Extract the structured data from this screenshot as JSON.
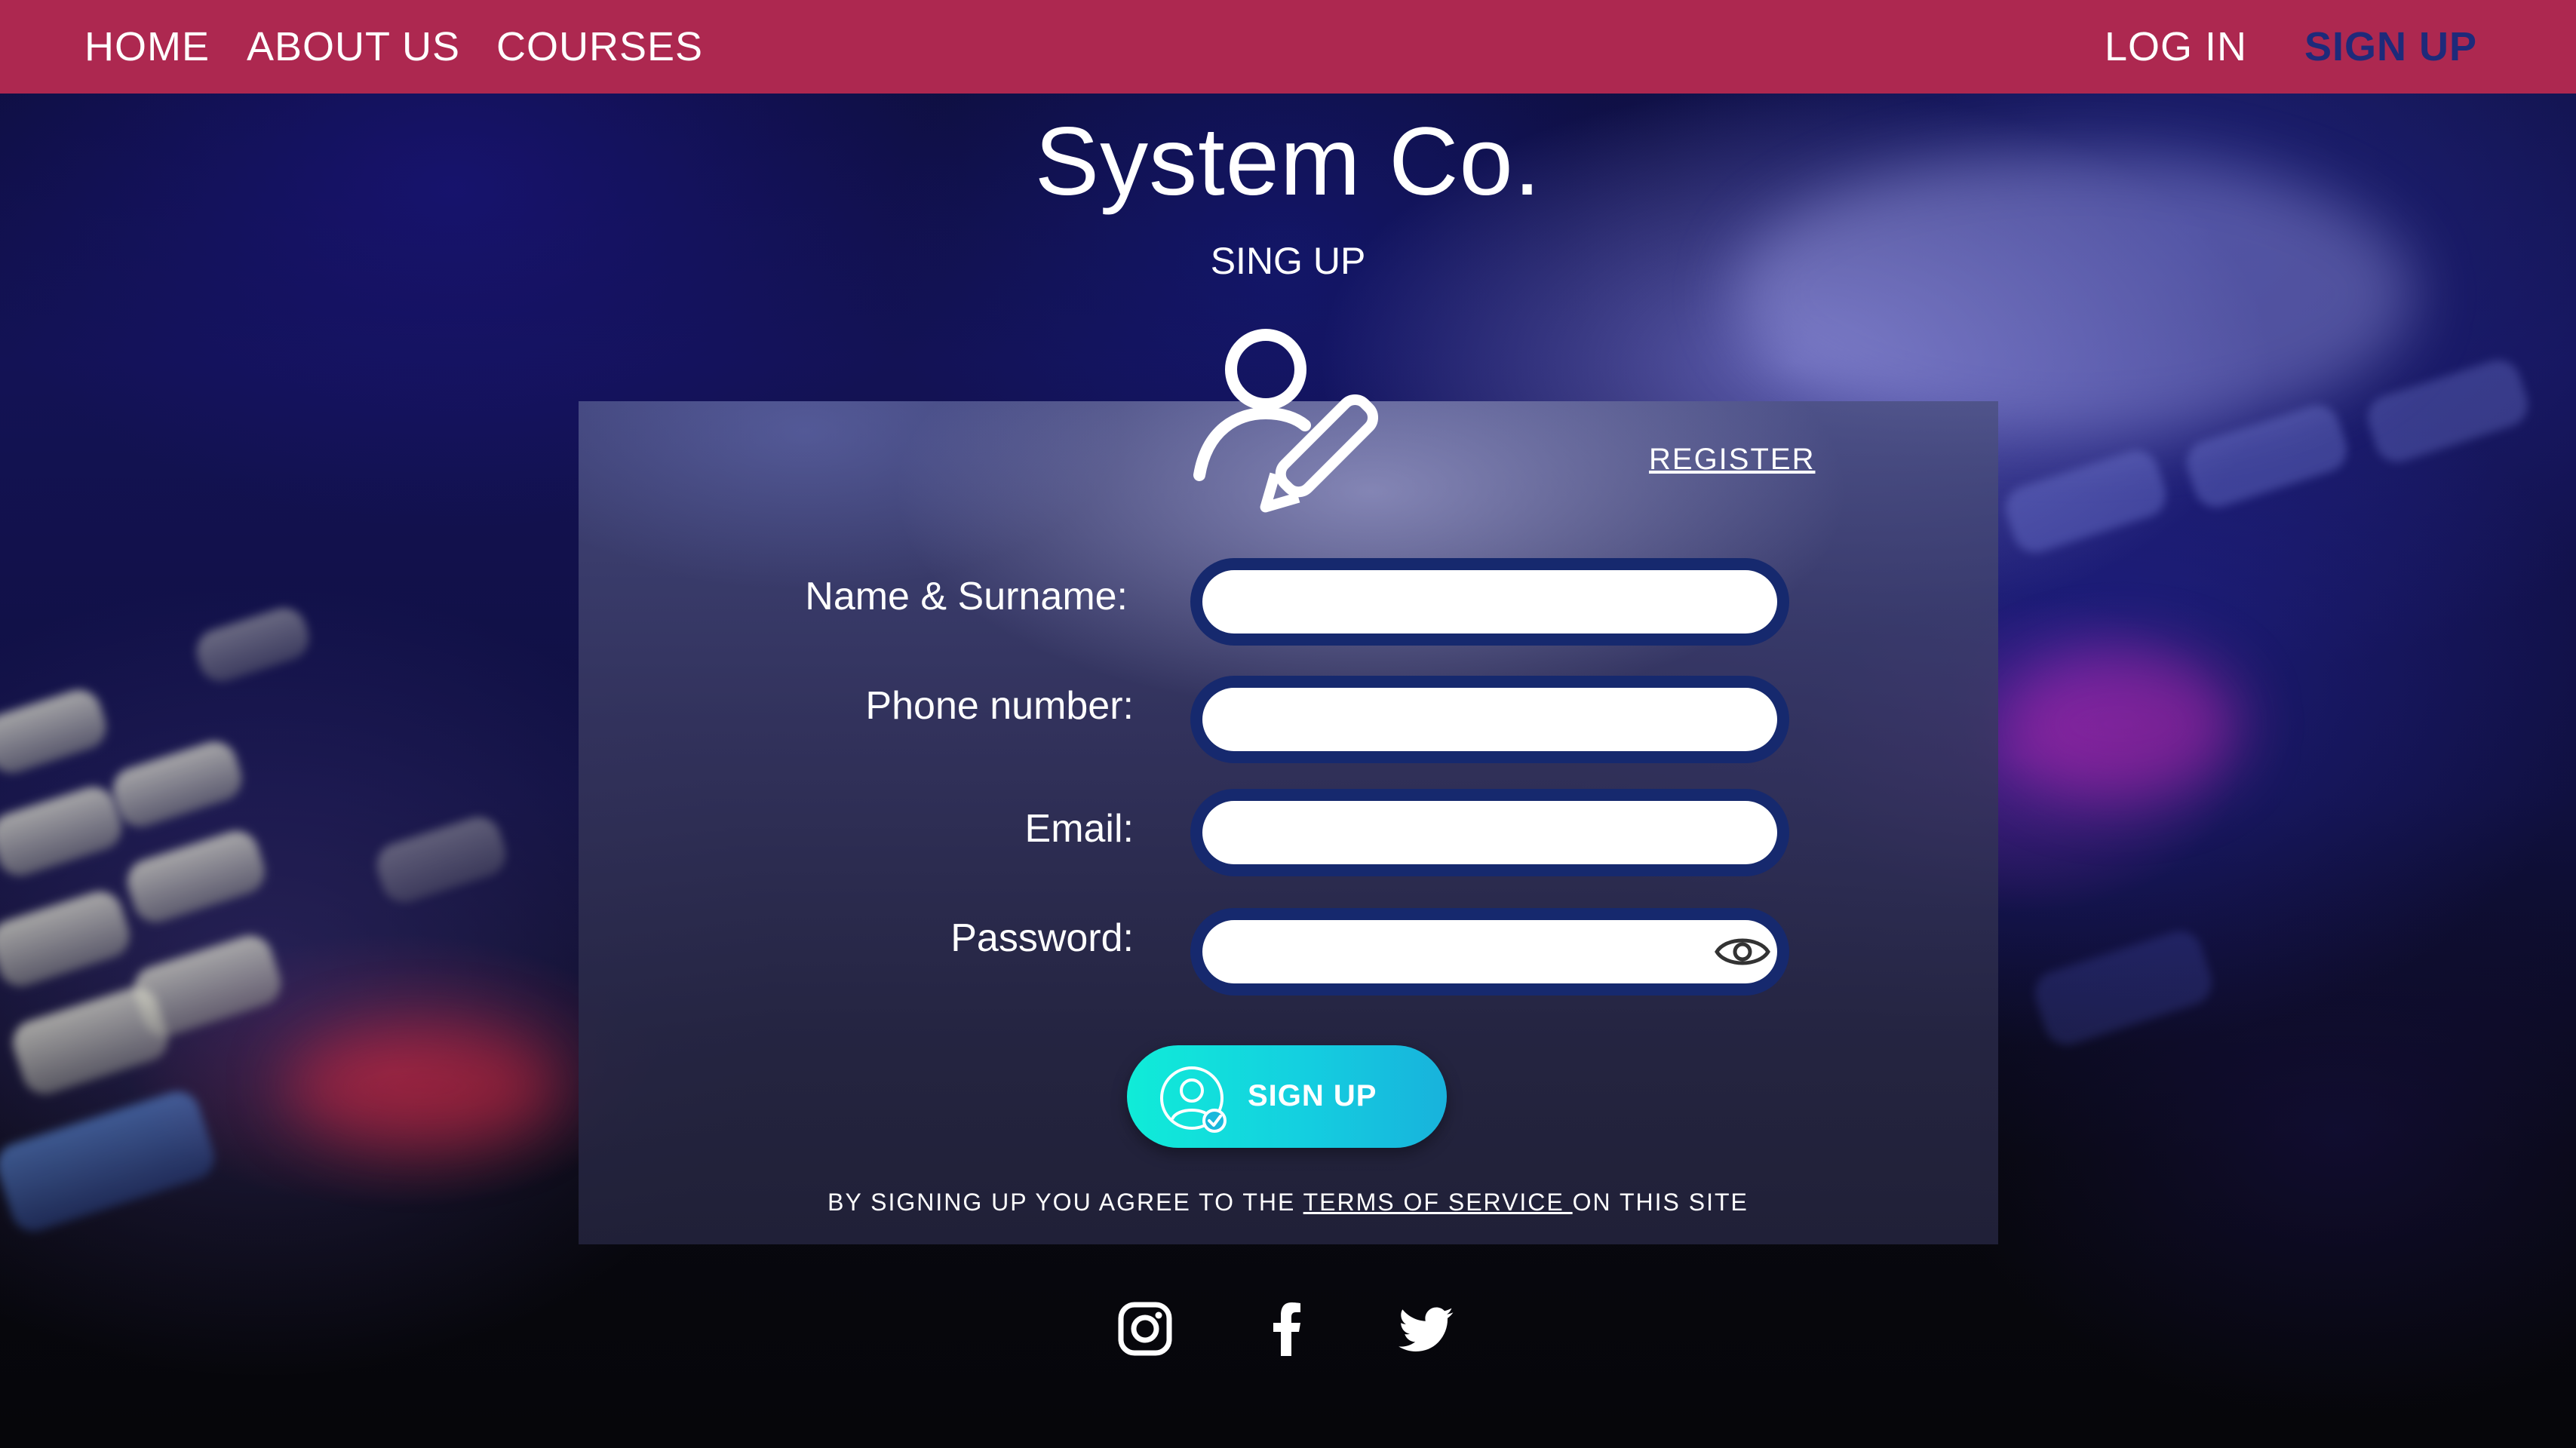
{
  "nav": {
    "home": "HOME",
    "about": "ABOUT US",
    "courses": "COURSES",
    "login": "LOG IN",
    "signup": "SIGN UP"
  },
  "header": {
    "brand": "System Co.",
    "subtitle": "SING UP"
  },
  "form": {
    "register_link": "REGISTER",
    "fields": [
      {
        "label": "Name & Surname:",
        "value": ""
      },
      {
        "label": "Phone number:",
        "value": ""
      },
      {
        "label": "Email:",
        "value": ""
      },
      {
        "label": "Password:",
        "value": ""
      }
    ],
    "submit_label": "SIGN UP",
    "terms_prefix": "BY SIGNING UP YOU AGREE TO THE ",
    "terms_link": "TERMS OF SERVICE ",
    "terms_suffix": "ON THIS SITE"
  },
  "social": {
    "icons": [
      "instagram-icon",
      "facebook-icon",
      "twitter-icon"
    ]
  },
  "colors": {
    "nav_bar": "#ad2850",
    "nav_active": "#1e2a7a",
    "input_border": "#16296e",
    "button_start": "#10ecd8",
    "button_end": "#18b2dc"
  }
}
